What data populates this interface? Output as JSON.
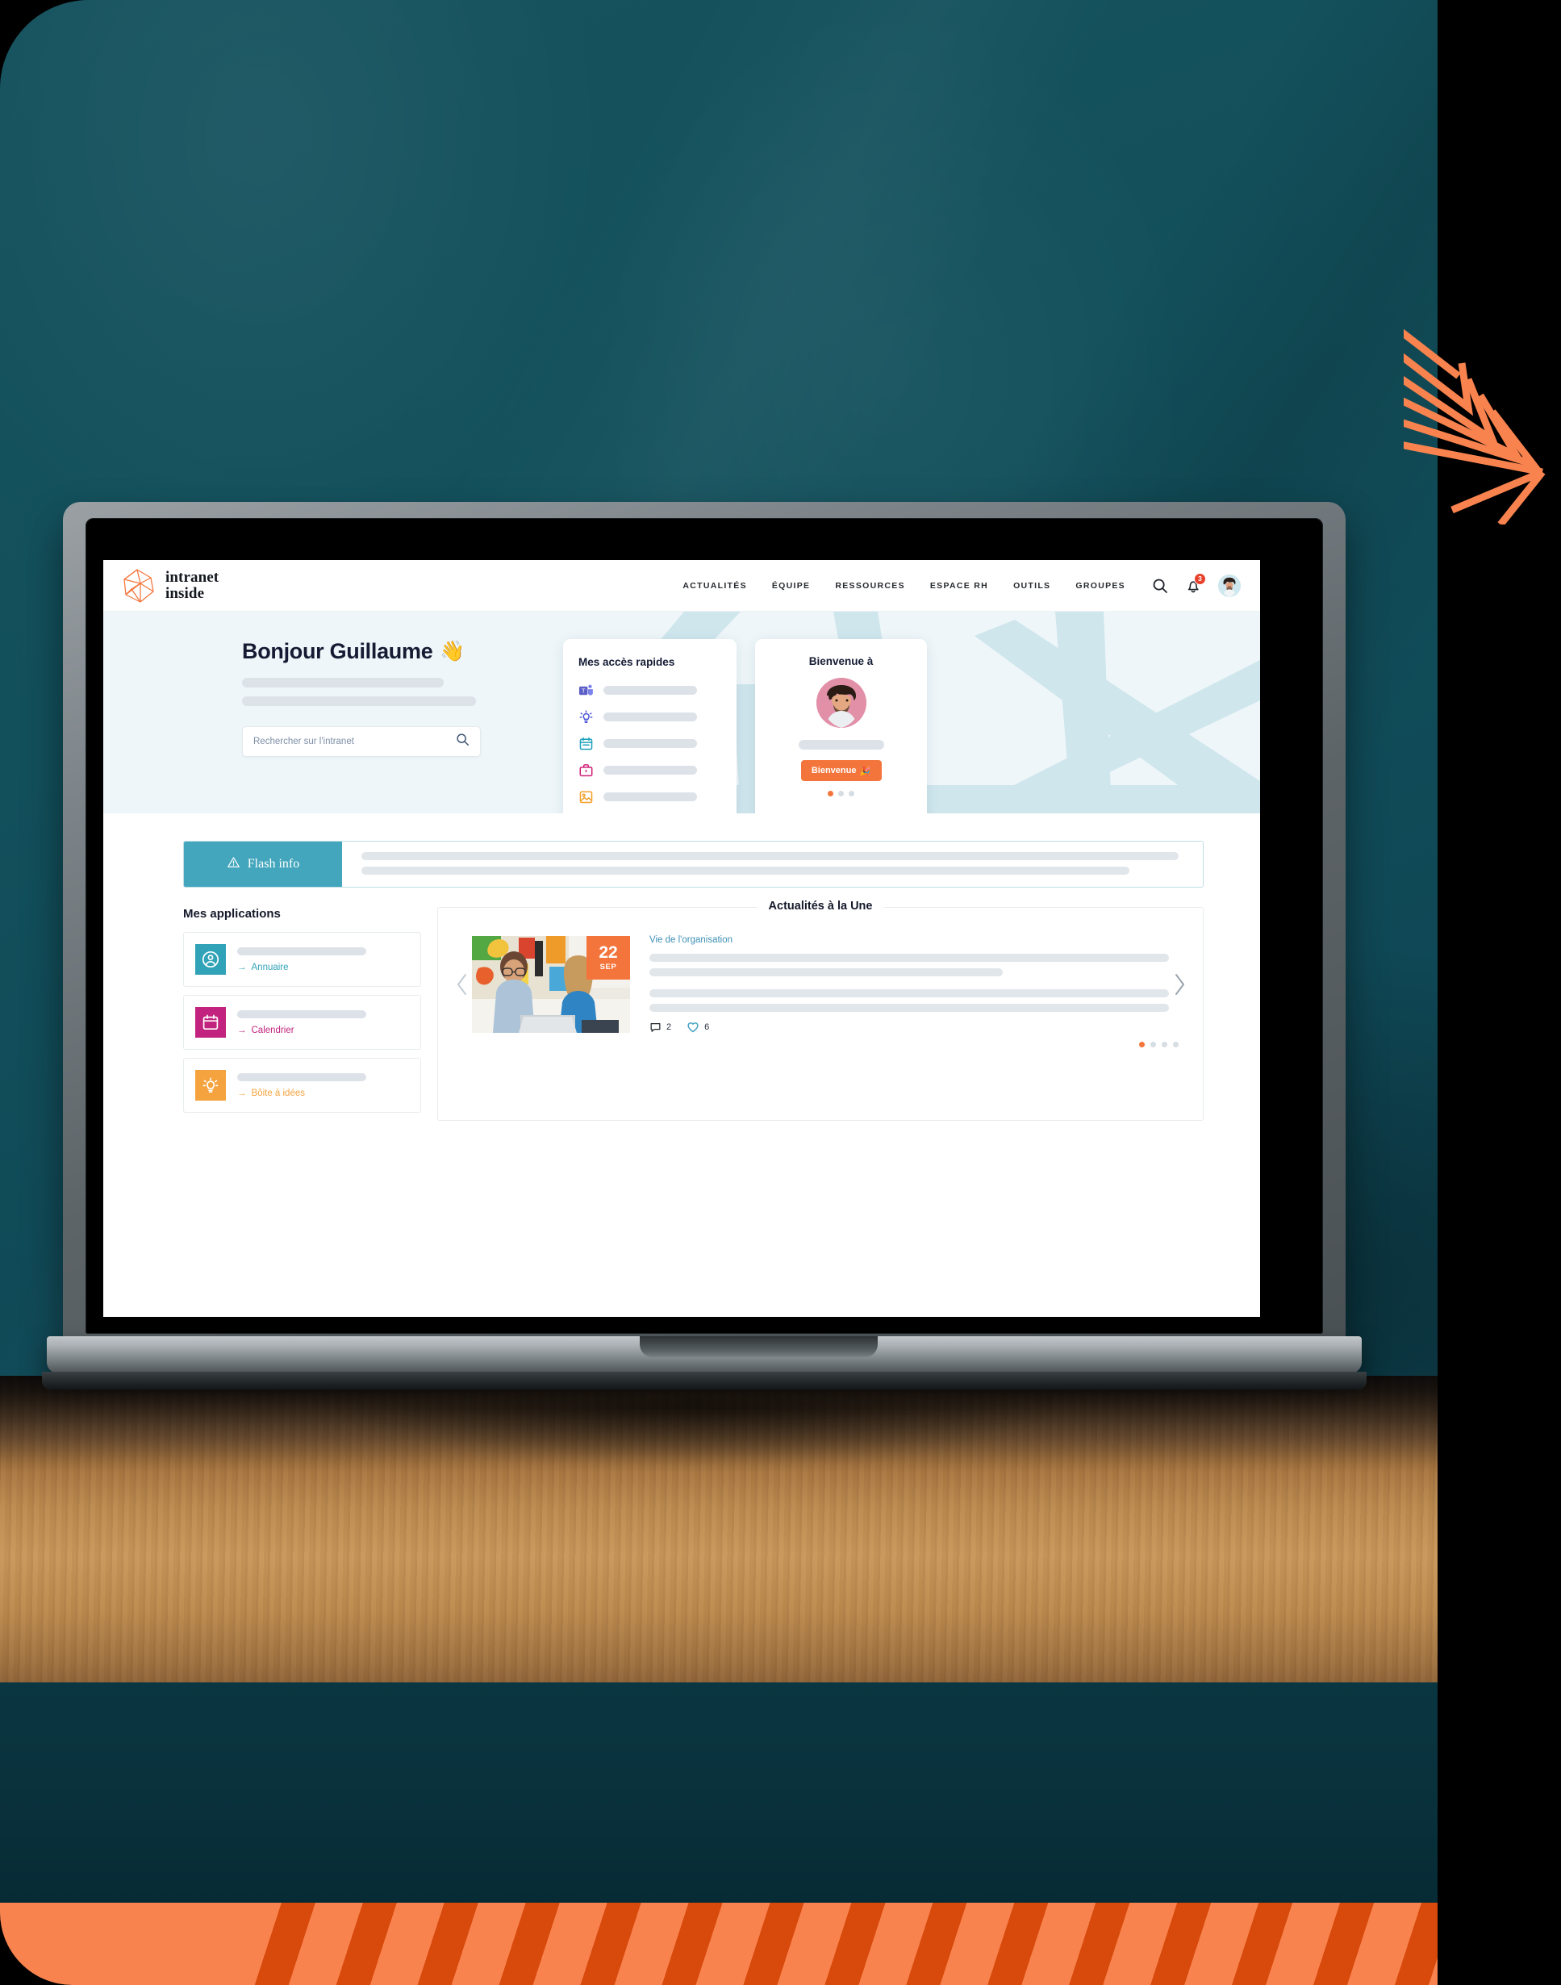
{
  "brand": {
    "line1": "intranet",
    "line2": "inside",
    "logo_color": "#f4753b"
  },
  "nav": {
    "items": [
      {
        "label": "ACTUALITÉS"
      },
      {
        "label": "ÉQUIPE"
      },
      {
        "label": "RESSOURCES"
      },
      {
        "label": "ESPACE RH"
      },
      {
        "label": "OUTILS"
      },
      {
        "label": "GROUPES"
      }
    ],
    "icons": {
      "search": "search-icon",
      "notifications": "bell-icon",
      "avatar": "user-avatar"
    },
    "notification_count": "3"
  },
  "hero": {
    "greeting": "Bonjour Guillaume",
    "greeting_emoji": "👋",
    "search": {
      "placeholder": "Rechercher sur l'intranet",
      "value": "",
      "icon": "search-icon"
    }
  },
  "quick_access": {
    "title": "Mes accès rapides",
    "items": [
      {
        "icon": "microsoft-teams-icon",
        "color": "#5b5fc7"
      },
      {
        "icon": "lightbulb-icon",
        "color": "#4b52d8"
      },
      {
        "icon": "calendar-icon",
        "color": "#1fa2bc"
      },
      {
        "icon": "briefcase-icon",
        "color": "#cf1f78"
      },
      {
        "icon": "image-icon",
        "color": "#f5a02d"
      }
    ]
  },
  "welcome": {
    "title": "Bienvenue à",
    "button_label": "Bienvenue",
    "button_emoji": "🎉",
    "button_color": "#f4753b",
    "dots": [
      true,
      false,
      false
    ]
  },
  "flash": {
    "label": "Flash info",
    "icon": "warning-triangle-icon",
    "color": "#43a6bc"
  },
  "apps": {
    "title": "Mes applications",
    "items": [
      {
        "label": "Annuaire",
        "icon": "user-circle-icon",
        "color": "#31a3b8",
        "arrow": "→"
      },
      {
        "label": "Calendrier",
        "icon": "calendar-icon",
        "color": "#c2237e",
        "arrow": "→"
      },
      {
        "label": "Bôite à idées",
        "icon": "lightbulb-icon",
        "color": "#f5a33f",
        "arrow": "→"
      }
    ]
  },
  "news": {
    "title": "Actualités à la Une",
    "category": "Vie de l'organisation",
    "category_color": "#3d8fb5",
    "date_day": "22",
    "date_month": "SEP",
    "date_color": "#f4753b",
    "comments": "2",
    "likes": "6",
    "prev_icon": "chevron-left-icon",
    "next_icon": "chevron-right-icon",
    "comment_icon": "comment-icon",
    "like_icon": "heart-icon",
    "dots": [
      true,
      false,
      false,
      false
    ]
  },
  "theme": {
    "background": "#12505c",
    "accent_orange": "#f4753b",
    "accent_teal": "#43a6bc",
    "hero_bg": "#eef6f9"
  }
}
